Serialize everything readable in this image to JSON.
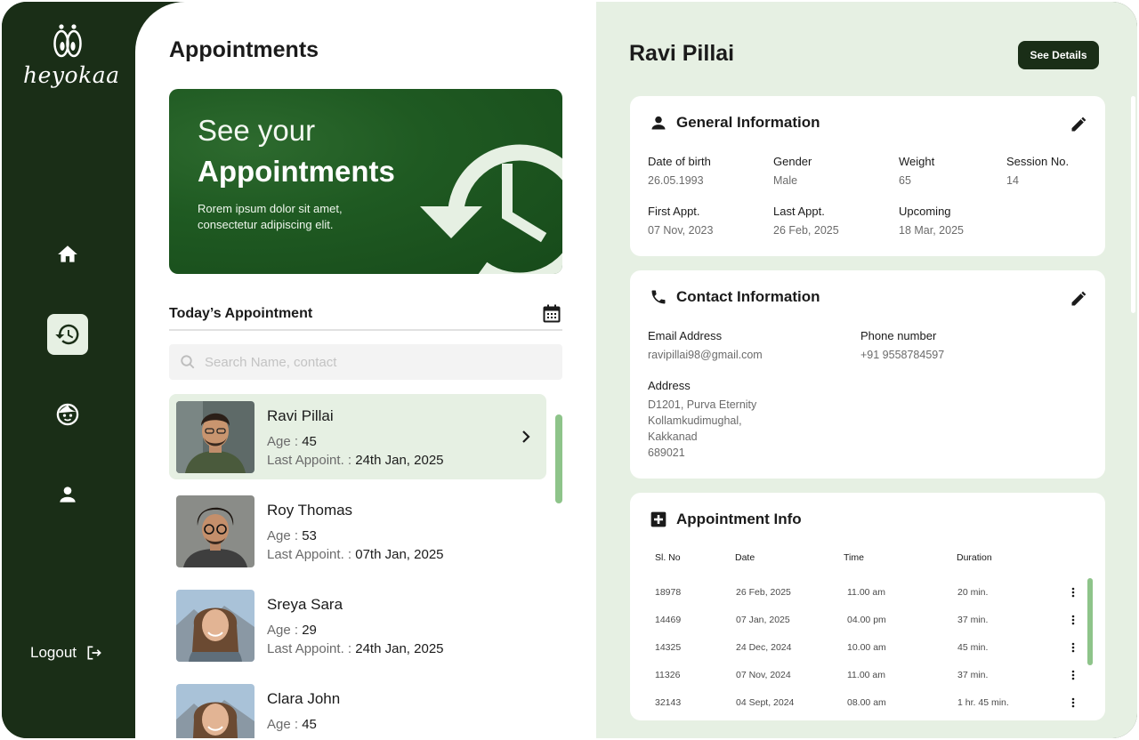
{
  "brand": {
    "name": "heyokaa"
  },
  "sidebar": {
    "items": [
      {
        "icon": "home-icon"
      },
      {
        "icon": "history-icon",
        "active": true
      },
      {
        "icon": "child-face-icon"
      },
      {
        "icon": "person-icon"
      }
    ],
    "logout_label": "Logout"
  },
  "appointments": {
    "title": "Appointments",
    "banner": {
      "line1": "See your",
      "line2": "Appointments",
      "subtitle": "Rorem ipsum dolor sit amet, consectetur adipiscing elit."
    },
    "today_title": "Today’s Appointment",
    "search_placeholder": "Search Name, contact",
    "age_label": "Age : ",
    "last_label": "Last Appoint. : ",
    "patients": [
      {
        "name": "Ravi Pillai",
        "age": "45",
        "last": "24th Jan, 2025",
        "selected": true
      },
      {
        "name": "Roy Thomas",
        "age": "53",
        "last": "07th Jan, 2025"
      },
      {
        "name": "Sreya Sara",
        "age": "29",
        "last": "24th Jan, 2025"
      },
      {
        "name": "Clara John",
        "age": "45",
        "last": ""
      }
    ]
  },
  "detail": {
    "name": "Ravi Pillai",
    "see_details": "See Details",
    "general": {
      "title": "General Information",
      "fields": {
        "dob_label": "Date of birth",
        "dob": "26.05.1993",
        "gender_label": "Gender",
        "gender": "Male",
        "weight_label": "Weight",
        "weight": "65",
        "session_label": "Session No.",
        "session": "14",
        "first_label": "First Appt.",
        "first": "07 Nov, 2023",
        "last_label": "Last Appt.",
        "last": "26 Feb, 2025",
        "upcoming_label": "Upcoming",
        "upcoming": "18 Mar, 2025"
      }
    },
    "contact": {
      "title": "Contact Information",
      "email_label": "Email Address",
      "email": "ravipillai98@gmail.com",
      "phone_label": "Phone number",
      "phone": "+91 9558784597",
      "address_label": "Address",
      "address_lines": [
        "D1201, Purva Eternity",
        "Kollamkudimughal,",
        "Kakkanad",
        "689021"
      ]
    },
    "appointment_info": {
      "title": "Appointment Info",
      "columns": [
        "Sl. No",
        "Date",
        "Time",
        "Duration"
      ],
      "rows": [
        [
          "18978",
          "26 Feb, 2025",
          "11.00 am",
          "20 min."
        ],
        [
          "14469",
          "07 Jan, 2025",
          "04.00 pm",
          "37 min."
        ],
        [
          "14325",
          "24 Dec, 2024",
          "10.00 am",
          "45 min."
        ],
        [
          "11326",
          "07 Nov, 2024",
          "11.00 am",
          "37 min."
        ],
        [
          "32143",
          "04 Sept, 2024",
          "08.00 am",
          "1 hr. 45 min."
        ]
      ]
    }
  },
  "colors": {
    "sidebar": "#1a2e17",
    "accent_light": "#e6f0e3",
    "scroll_green": "#8ec48a",
    "banner_green": "#1f5a22"
  }
}
